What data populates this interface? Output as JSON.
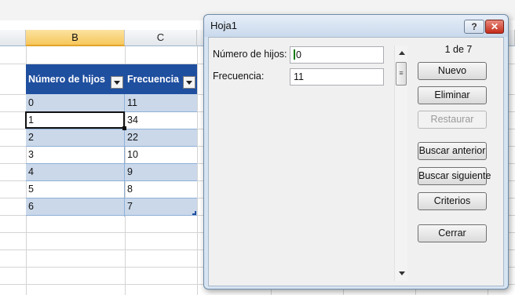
{
  "sheet": {
    "columns": [
      "B",
      "C"
    ],
    "selected_column": "B",
    "table": {
      "headers": [
        "Número de hijos",
        "Frecuencia"
      ],
      "rows": [
        [
          "0",
          "11"
        ],
        [
          "1",
          "34"
        ],
        [
          "2",
          "22"
        ],
        [
          "3",
          "10"
        ],
        [
          "4",
          "9"
        ],
        [
          "5",
          "8"
        ],
        [
          "6",
          "7"
        ]
      ],
      "active_row_index": 1
    }
  },
  "dialog": {
    "title": "Hoja1",
    "help_label": "?",
    "close_label": "✕",
    "record_counter": "1 de 7",
    "fields": [
      {
        "label": "Número de hijos:",
        "value": "0"
      },
      {
        "label": "Frecuencia:",
        "value": "11"
      }
    ],
    "buttons": {
      "nuevo": "Nuevo",
      "eliminar": "Eliminar",
      "restaurar": "Restaurar",
      "buscar_anterior": "Buscar anterior",
      "buscar_siguiente": "Buscar siguiente",
      "criterios": "Criterios",
      "cerrar": "Cerrar"
    },
    "restaurar_enabled": false
  },
  "colors": {
    "table_header": "#1f4f9f",
    "table_band": "#cad8ea",
    "selected_column_header": "#f7c75c",
    "close_button": "#c42b19"
  }
}
